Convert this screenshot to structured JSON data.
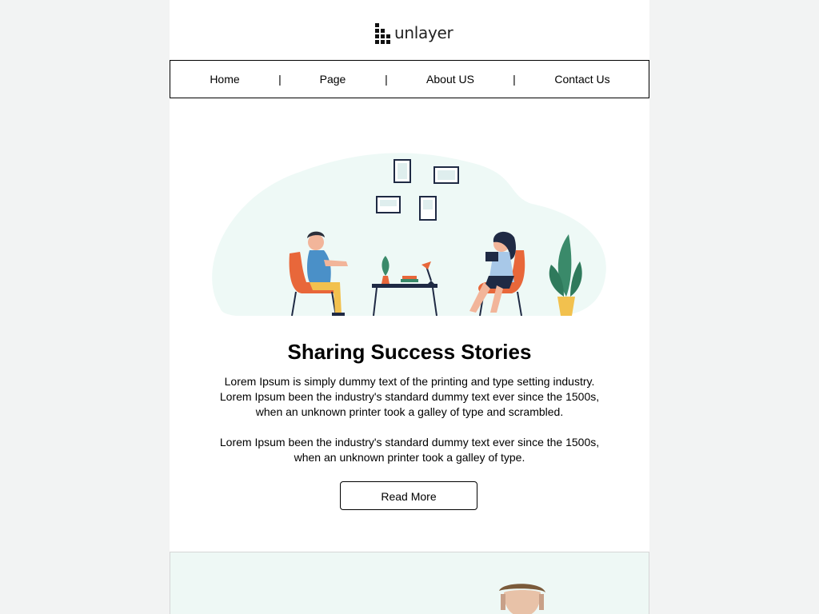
{
  "logo": {
    "text": "unlayer",
    "icon": "unlayer-logo-icon"
  },
  "nav": {
    "items": [
      "Home",
      "Page",
      "About US",
      "Contact Us"
    ],
    "separator": "|"
  },
  "hero": {
    "illustration": "two-people-talking-illustration"
  },
  "content": {
    "heading": "Sharing Success Stories",
    "paragraph1": "Lorem Ipsum is simply dummy text of the printing and type setting industry. Lorem Ipsum been the industry's standard dummy text ever since the 1500s, when an unknown printer took a galley of type and scrambled.",
    "paragraph2": "Lorem Ipsum been the industry's standard dummy text ever since the 1500s, when an unknown printer took a galley of type.",
    "button_label": "Read More"
  },
  "section2": {
    "image": "man-portrait-photo"
  },
  "colors": {
    "page_bg": "#f2f3f3",
    "card_bg": "#ffffff",
    "hero_blob": "#eef9f6",
    "accent_orange": "#e8673a",
    "plant_green": "#3a8a6a",
    "section2_bg": "#eef8f5"
  }
}
